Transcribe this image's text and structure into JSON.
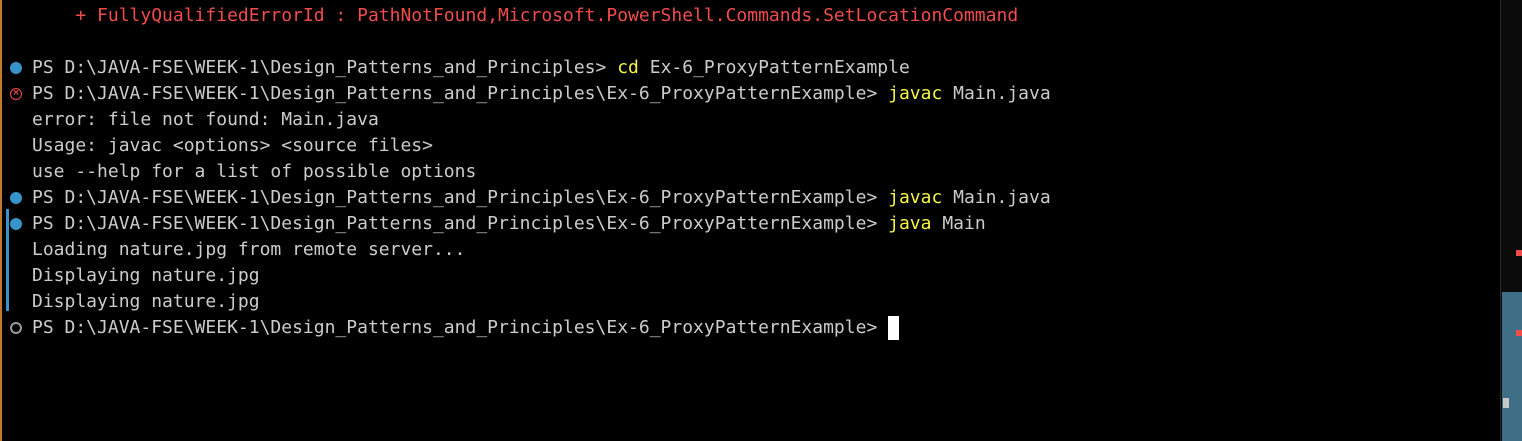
{
  "terminal": {
    "lines": [
      {
        "type": "error",
        "text": "    + FullyQualifiedErrorId : PathNotFound,Microsoft.PowerShell.Commands.SetLocationCommand"
      },
      {
        "type": "prompt",
        "status": "success",
        "prompt": "PS D:\\JAVA-FSE\\WEEK-1\\Design_Patterns_and_Principles> ",
        "command": "cd",
        "args": " Ex-6_ProxyPatternExample"
      },
      {
        "type": "prompt",
        "status": "error",
        "prompt": "PS D:\\JAVA-FSE\\WEEK-1\\Design_Patterns_and_Principles\\Ex-6_ProxyPatternExample> ",
        "command": "javac",
        "args": " Main.java"
      },
      {
        "type": "output",
        "text": "error: file not found: Main.java"
      },
      {
        "type": "output",
        "text": "Usage: javac <options> <source files>"
      },
      {
        "type": "output",
        "text": "use --help for a list of possible options"
      },
      {
        "type": "prompt",
        "status": "success",
        "prompt": "PS D:\\JAVA-FSE\\WEEK-1\\Design_Patterns_and_Principles\\Ex-6_ProxyPatternExample> ",
        "command": "javac",
        "args": " Main.java"
      },
      {
        "type": "prompt",
        "status": "success",
        "prompt": "PS D:\\JAVA-FSE\\WEEK-1\\Design_Patterns_and_Principles\\Ex-6_ProxyPatternExample> ",
        "command": "java",
        "args": " Main"
      },
      {
        "type": "output",
        "text": "Loading nature.jpg from remote server..."
      },
      {
        "type": "output",
        "text": "Displaying nature.jpg"
      },
      {
        "type": "output",
        "text": "Displaying nature.jpg"
      },
      {
        "type": "prompt",
        "status": "idle",
        "prompt": "PS D:\\JAVA-FSE\\WEEK-1\\Design_Patterns_and_Principles\\Ex-6_ProxyPatternExample> ",
        "command": "",
        "args": "",
        "cursor": true
      }
    ]
  },
  "colors": {
    "background": "#000000",
    "text": "#cccccc",
    "error": "#f14c4c",
    "command": "#f5f543",
    "success_decoration": "#3794c9",
    "scrollbar_thumb": "#3e6f86"
  },
  "icons": {
    "success": "filled-circle-icon",
    "error": "circle-x-icon",
    "idle": "hollow-circle-icon"
  }
}
